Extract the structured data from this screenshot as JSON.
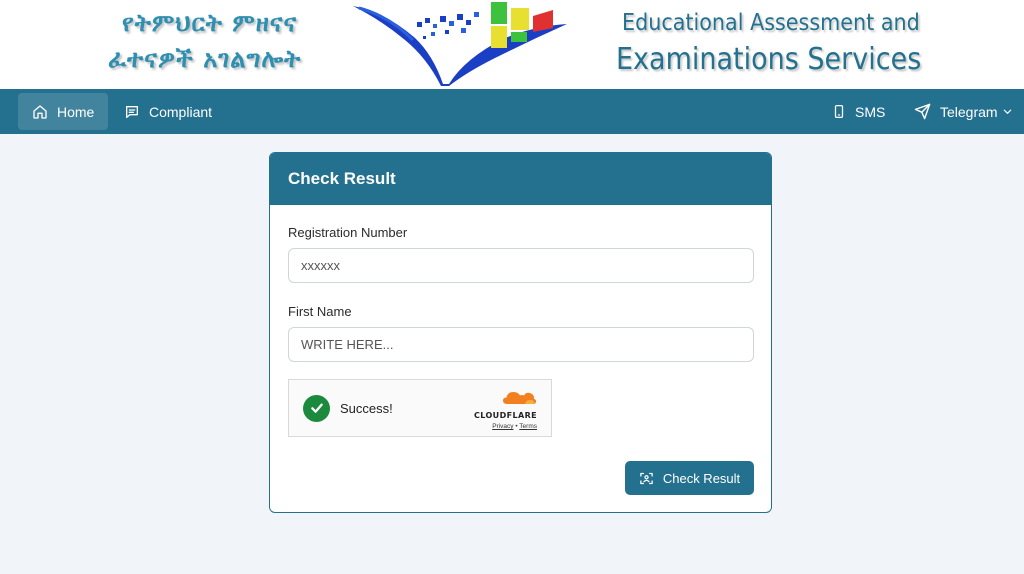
{
  "banner": {
    "amharic_line1": "የትምህርት ምዘናና",
    "amharic_line2": "ፈተናዎች አገልግሎት",
    "english_line1": "Educational Assessment and",
    "english_line2": "Examinations Services"
  },
  "navbar": {
    "left": [
      {
        "label": "Home",
        "icon": "home-icon",
        "active": true
      },
      {
        "label": "Compliant",
        "icon": "message-square-icon",
        "active": false
      }
    ],
    "right": [
      {
        "label": "SMS",
        "icon": "smartphone-icon"
      },
      {
        "label": "Telegram",
        "icon": "send-icon",
        "dropdown_icon": "chevron-down-icon"
      }
    ]
  },
  "card": {
    "title": "Check Result",
    "fields": [
      {
        "label": "Registration Number",
        "placeholder": "xxxxxx",
        "value": ""
      },
      {
        "label": "First Name",
        "placeholder": "WRITE HERE...",
        "value": ""
      }
    ],
    "captcha": {
      "status": "Success!",
      "brand": "CLOUDFLARE",
      "privacy": "Privacy",
      "separator": "•",
      "terms": "Terms"
    },
    "submit_label": "Check Result",
    "submit_icon": "scan-face-icon"
  },
  "colors": {
    "primary": "#24708f",
    "page_background": "#f1f4f8",
    "success": "#1c8a3c",
    "cloudflare_orange": "#f38020"
  }
}
